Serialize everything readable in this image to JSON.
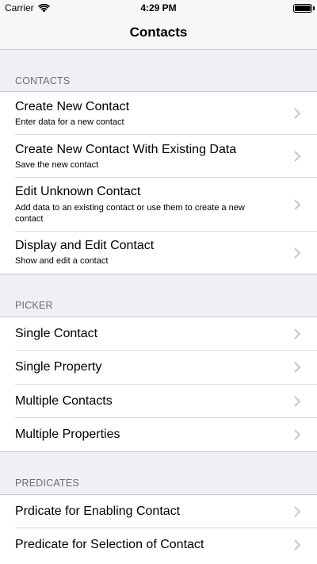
{
  "status": {
    "carrier": "Carrier",
    "time": "4:29 PM"
  },
  "nav": {
    "title": "Contacts"
  },
  "sections": {
    "contacts": {
      "header": "CONTACTS",
      "items": [
        {
          "title": "Create New Contact",
          "subtitle": "Enter data for a new contact"
        },
        {
          "title": "Create New Contact With Existing Data",
          "subtitle": "Save the new contact"
        },
        {
          "title": "Edit Unknown Contact",
          "subtitle": "Add data to an existing contact or use them to create a new contact"
        },
        {
          "title": "Display and Edit Contact",
          "subtitle": "Show and edit a contact"
        }
      ]
    },
    "picker": {
      "header": "PICKER",
      "items": [
        {
          "title": "Single Contact"
        },
        {
          "title": "Single Property"
        },
        {
          "title": "Multiple Contacts"
        },
        {
          "title": "Multiple Properties"
        }
      ]
    },
    "predicates": {
      "header": "PREDICATES",
      "items": [
        {
          "title": "Prdicate for Enabling Contact"
        },
        {
          "title": "Predicate for Selection of Contact"
        }
      ]
    }
  }
}
